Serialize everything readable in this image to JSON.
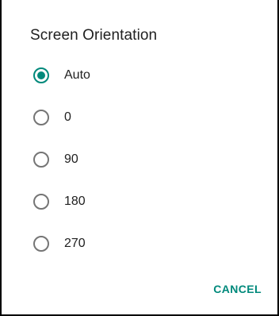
{
  "dialog": {
    "title": "Screen Orientation",
    "selected": "Auto",
    "options": [
      {
        "label": "Auto",
        "checked": true
      },
      {
        "label": "0",
        "checked": false
      },
      {
        "label": "90",
        "checked": false
      },
      {
        "label": "180",
        "checked": false
      },
      {
        "label": "270",
        "checked": false
      }
    ],
    "cancel_label": "CANCEL"
  },
  "colors": {
    "accent": "#00897b",
    "radio_unchecked": "#757575",
    "text": "#212121",
    "background": "#ffffff"
  },
  "icons": {
    "radio_checked": "radio-checked-icon",
    "radio_unchecked": "radio-unchecked-icon"
  }
}
